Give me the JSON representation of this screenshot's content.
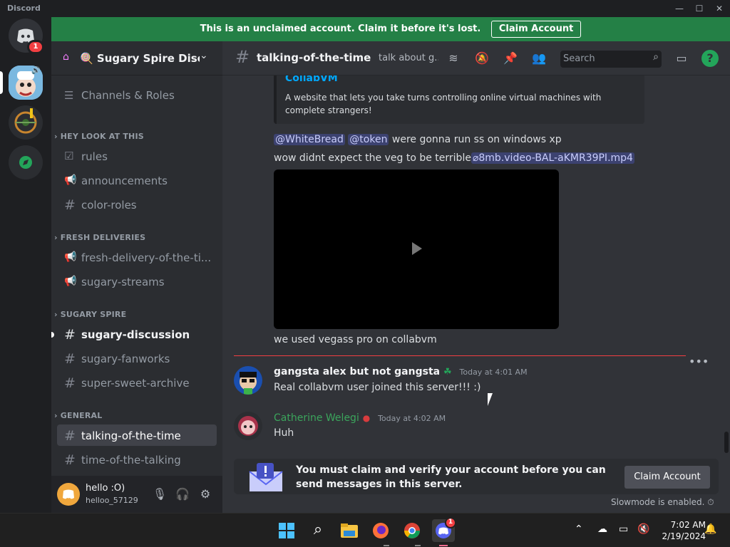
{
  "window": {
    "app_title": "Discord"
  },
  "banner": {
    "text": "This is an unclaimed account. Claim it before it's lost.",
    "button": "Claim Account"
  },
  "guilds": {
    "home_badge": "1"
  },
  "server": {
    "name": "🍭 Sugary Spire Discord"
  },
  "sidebar": {
    "channels_roles": "Channels & Roles",
    "categories": {
      "hey_look": "HEY LOOK AT THIS",
      "fresh": "FRESH DELIVERIES",
      "sugary": "SUGARY SPIRE",
      "general": "GENERAL"
    },
    "channels": {
      "rules": "rules",
      "announcements": "announcements",
      "color_roles": "color-roles",
      "fresh_delivery": "fresh-delivery-of-the-ti...",
      "sugary_streams": "sugary-streams",
      "sugary_discussion": "sugary-discussion",
      "sugary_fanworks": "sugary-fanworks",
      "super_sweet_archive": "super-sweet-archive",
      "talking_of_the_time": "talking-of-the-time",
      "time_of_the_talking": "time-of-the-talking"
    }
  },
  "user": {
    "name": "hello :O)",
    "tag": "helloo_57129"
  },
  "chat": {
    "channel_name": "talking-of-the-time",
    "topic": "talk about g...",
    "search_placeholder": "Search",
    "embed_title": "CollabVM",
    "embed_desc": "A website that lets you take turns controlling online virtual machines with complete strangers!",
    "mention1": "@WhiteBread",
    "mention2": "@token",
    "msg1_rest": " were gonna run ss on windows xp",
    "msg2_text": "wow didnt expect the veg to be terrible",
    "msg2_attachment": "8mb.video-BAL-aKMR39PI.mp4",
    "msg3_text": "we used vegass pro on collabvm",
    "messages": [
      {
        "author": "gangsta alex but not gangsta",
        "time": "Today at 4:01 AM",
        "text": "Real collabvm user joined this server!!! :)",
        "author_color": "#f2f3f5"
      },
      {
        "author": "Catherine Welegi",
        "time": "Today at 4:02 AM",
        "text": "Huh",
        "author_color": "#3ba55c"
      }
    ],
    "claim_text": "You must claim and verify your account before you can send messages in this server.",
    "claim_button": "Claim Account",
    "slowmode": "Slowmode is enabled."
  },
  "taskbar": {
    "time": "7:02 AM",
    "date": "2/19/2024",
    "discord_badge": "1"
  }
}
